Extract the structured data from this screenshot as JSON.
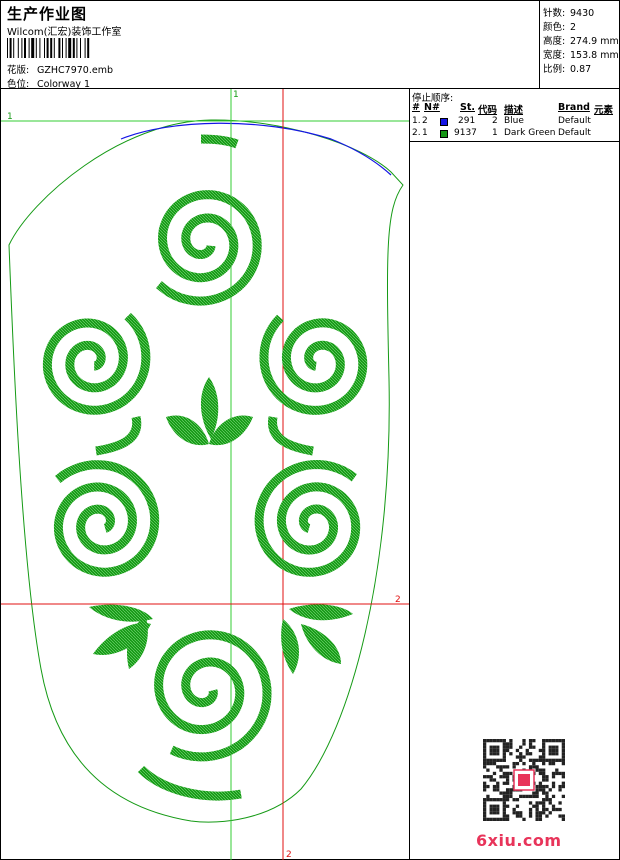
{
  "header": {
    "title": "生产作业图",
    "company": "Wilcom(汇宏)装饰工作室",
    "design_label": "花版:",
    "design_value": "GZHC7970.emb",
    "colorway_label": "色位:",
    "colorway_value": "Colorway 1"
  },
  "stats": [
    {
      "label": "针数:",
      "value": "9430"
    },
    {
      "label": "颜色:",
      "value": "2"
    },
    {
      "label": "高度:",
      "value": "274.9 mm"
    },
    {
      "label": "宽度:",
      "value": "153.8 mm"
    },
    {
      "label": "比例:",
      "value": "0.87"
    }
  ],
  "stop_sequence": {
    "title": "停止顺序:",
    "columns": [
      "#",
      "N#",
      "St.",
      "代码",
      "描述",
      "Brand",
      "元素"
    ],
    "rows": [
      {
        "idx": "1.",
        "n": "2",
        "color": "#1515e6",
        "stitches": "291",
        "code": "2",
        "desc": "Blue",
        "brand": "Default"
      },
      {
        "idx": "2.",
        "n": "1",
        "color": "#159615",
        "stitches": "9137",
        "code": "1",
        "desc": "Dark Green",
        "brand": "Default"
      }
    ]
  },
  "guides": {
    "v1": "1",
    "h1": "1",
    "v2": "2",
    "h2": "2"
  },
  "colors": {
    "green": "#159a15",
    "blue": "#1515e6",
    "red": "#e01010",
    "guide_green": "#33cc33"
  },
  "watermark": {
    "text": "6xiu.com"
  }
}
